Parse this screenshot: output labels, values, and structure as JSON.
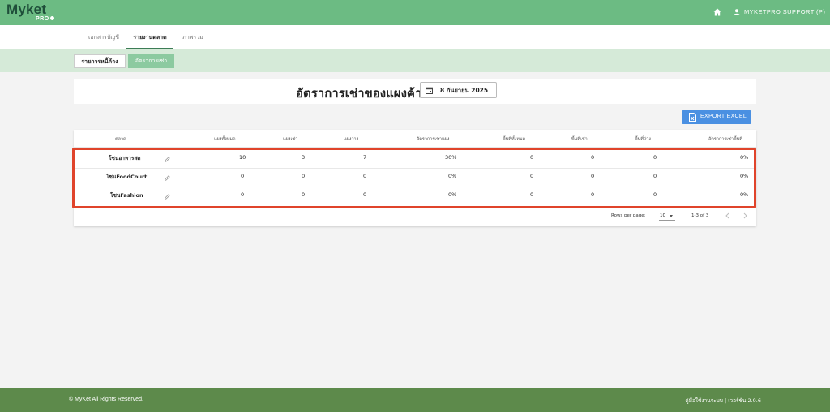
{
  "header": {
    "logo_text": "Myket",
    "logo_sub": "PRO",
    "user_name": "MYKETPRO SUPPORT (P)"
  },
  "tabs": [
    {
      "label": "เอกสารบัญชี",
      "active": false
    },
    {
      "label": "รายงานตลาด",
      "active": true
    },
    {
      "label": "ภาพรวม",
      "active": false
    }
  ],
  "subnav": {
    "outstanding_label": "รายการหนี้ค้าง",
    "rental_rate_label": "อัตราการเช่า"
  },
  "page": {
    "title": "อัตราการเช่าของแผงค้า",
    "date": "8 กันยายน 2025",
    "export_label": "EXPORT EXCEL"
  },
  "table": {
    "headers": [
      "ตลาด",
      "แผงทั้งหมด",
      "แผงเช่า",
      "แผงว่าง",
      "อัตราการเช่าแผง",
      "พื้นที่ทั้งหมด",
      "พื้นที่เช่า",
      "พื้นที่ว่าง",
      "อัตราการเช่าพื้นที่"
    ],
    "rows": [
      {
        "market": "โซนอาหารสด",
        "total_stalls": "10",
        "rented_stalls": "3",
        "vacant_stalls": "7",
        "stall_rate": "30%",
        "total_area": "0",
        "rented_area": "0",
        "vacant_area": "0",
        "area_rate": "0%"
      },
      {
        "market": "โซนFoodCourt",
        "total_stalls": "0",
        "rented_stalls": "0",
        "vacant_stalls": "0",
        "stall_rate": "0%",
        "total_area": "0",
        "rented_area": "0",
        "vacant_area": "0",
        "area_rate": "0%"
      },
      {
        "market": "โซนFashion",
        "total_stalls": "0",
        "rented_stalls": "0",
        "vacant_stalls": "0",
        "stall_rate": "0%",
        "total_area": "0",
        "rented_area": "0",
        "vacant_area": "0",
        "area_rate": "0%"
      }
    ]
  },
  "pagination": {
    "rows_per_page_label": "Rows per page:",
    "rows_per_page_value": "10",
    "range": "1-3 of 3"
  },
  "footer": {
    "copyright": "© MyKet All Rights Reserved.",
    "manual": "คู่มือใช้งานระบบ | เวอร์ชั่น 2.0.6"
  },
  "colors": {
    "topbar": "#6cbb83",
    "subbar": "#d5ead8",
    "export": "#4a90e2",
    "highlight": "#e0442b",
    "footer": "#5d8a4b"
  },
  "icons": [
    "home-icon",
    "user-icon",
    "calendar-icon",
    "excel-icon",
    "edit-icon",
    "chevron-left-icon",
    "chevron-right-icon",
    "caret-down-icon"
  ]
}
